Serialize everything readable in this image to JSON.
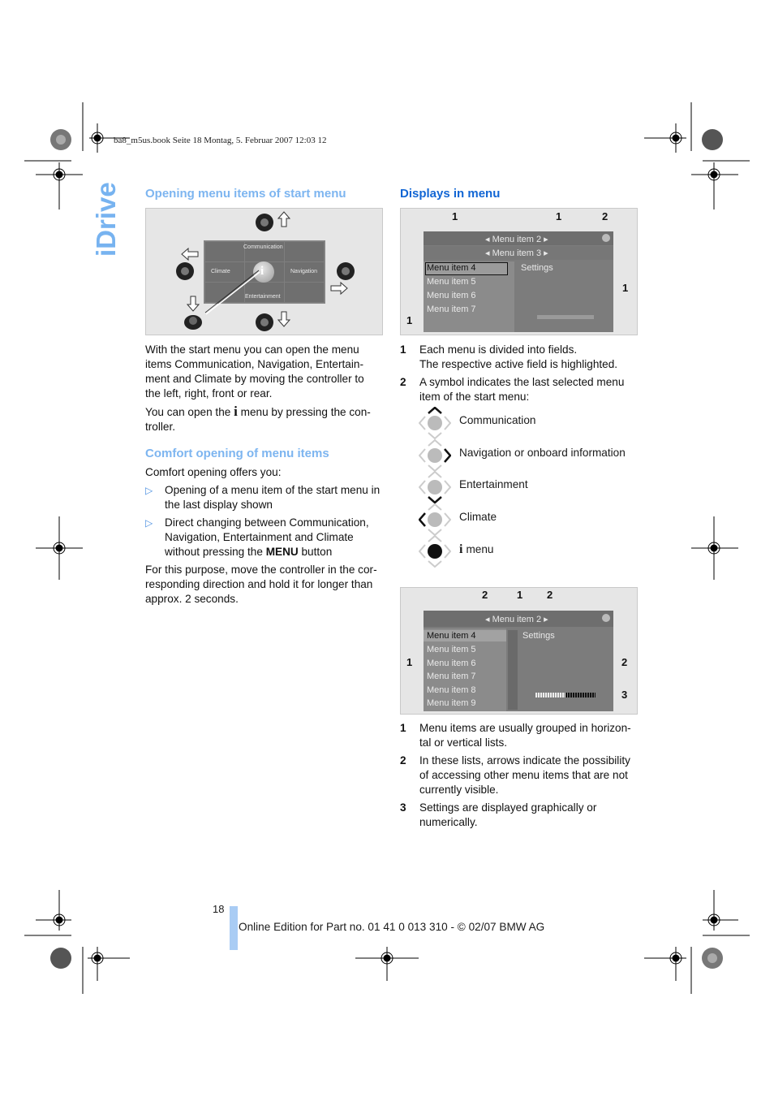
{
  "header": {
    "slug": "ba8_m5us.book  Seite 18  Montag, 5. Februar 2007  12:03 12",
    "side_tab": "iDrive"
  },
  "left": {
    "heading1": "Opening menu items of start menu",
    "figure1": {
      "labels": {
        "top": "Communication",
        "left": "Climate",
        "right": "Navigation",
        "bottom": "Entertainment",
        "center": "i"
      }
    },
    "para1": "With the start menu you can open the menu items Communication, Navigation, Entertain-ment and Climate by moving the controller to the left, right, front or rear.",
    "para2_before": "You can open the",
    "para2_icon": "i",
    "para2_after": "menu by pressing the con-troller.",
    "heading2": "Comfort opening of menu items",
    "para3": "Comfort opening offers you:",
    "bullets": [
      {
        "text": "Opening of a menu item of the start menu in the last display shown"
      },
      {
        "text_before": "Direct changing between Communication, Navigation, Entertainment and Climate without pressing the",
        "menu_word": "MENU",
        "text_after": "button"
      }
    ],
    "bullet_glyph": "▷",
    "para4": "For this purpose, move the controller in the cor-responding direction and hold it for longer than approx. 2 seconds."
  },
  "right": {
    "heading": "Displays in menu",
    "figure1": {
      "row1": "◂ Menu item 2 ▸",
      "row2": "◂ Menu item 3 ▸",
      "list": [
        "Menu item 4",
        "Menu item 5",
        "Menu item 6",
        "Menu item 7"
      ],
      "settings": "Settings",
      "callouts": [
        "1",
        "1",
        "2",
        "1",
        "1"
      ]
    },
    "items1": [
      {
        "n": "1",
        "text": "Each menu is divided into fields.",
        "text2": "The respective active field is highlighted."
      },
      {
        "n": "2",
        "text": "A symbol indicates the last selected menu item of the start menu:"
      }
    ],
    "symbols": [
      {
        "icon": "controller-up-icon",
        "label": "Communication"
      },
      {
        "icon": "controller-right-icon",
        "label": "Navigation or onboard information"
      },
      {
        "icon": "controller-down-icon",
        "label": "Entertainment"
      },
      {
        "icon": "controller-left-icon",
        "label": "Climate"
      },
      {
        "icon": "controller-press-icon",
        "label_icon": "i",
        "label": "menu"
      }
    ],
    "figure2": {
      "row1": "◂ Menu item 2 ▸",
      "list": [
        "Menu item 4",
        "Menu item 5",
        "Menu item 6",
        "Menu item 7",
        "Menu item 8",
        "Menu item 9"
      ],
      "settings": "Settings",
      "callouts": [
        "2",
        "1",
        "2",
        "1",
        "2",
        "3"
      ],
      "slider_value_fraction": 0.5
    },
    "items2": [
      {
        "n": "1",
        "text": "Menu items are usually grouped in horizon-tal or vertical lists."
      },
      {
        "n": "2",
        "text": "In these lists, arrows indicate the possibility of accessing other menu items that are not currently visible."
      },
      {
        "n": "3",
        "text": "Settings are displayed graphically or numerically."
      }
    ]
  },
  "footer": {
    "page_number": "18",
    "text": "Online Edition for Part no. 01 41 0 013 310 - © 02/07 BMW AG"
  },
  "colors": {
    "heading_light": "#7db5f0",
    "heading_dark": "#1266d4",
    "footer_bar": "#a9ccf4"
  }
}
